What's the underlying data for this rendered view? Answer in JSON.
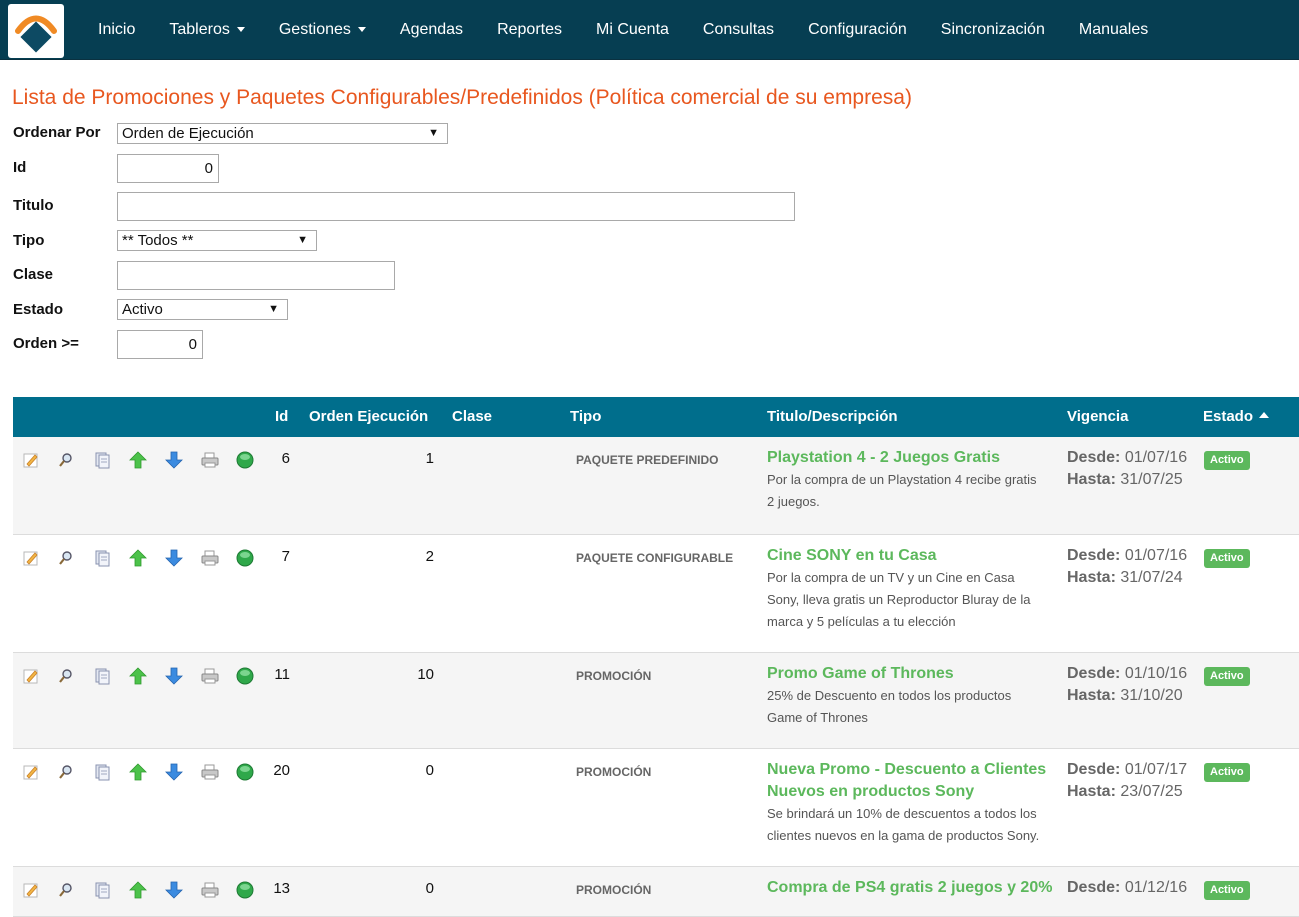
{
  "nav": {
    "items": [
      {
        "label": "Inicio",
        "dropdown": false
      },
      {
        "label": "Tableros",
        "dropdown": true
      },
      {
        "label": "Gestiones",
        "dropdown": true
      },
      {
        "label": "Agendas",
        "dropdown": false
      },
      {
        "label": "Reportes",
        "dropdown": false
      },
      {
        "label": "Mi Cuenta",
        "dropdown": false
      },
      {
        "label": "Consultas",
        "dropdown": false
      },
      {
        "label": "Configuración",
        "dropdown": false
      },
      {
        "label": "Sincronización",
        "dropdown": false
      },
      {
        "label": "Manuales",
        "dropdown": false
      }
    ]
  },
  "page_title": "Lista de Promociones y Paquetes Configurables/Predefinidos (Política comercial de su empresa)",
  "filters": {
    "ordenar_por": {
      "label": "Ordenar Por",
      "value": "Orden de Ejecución"
    },
    "id": {
      "label": "Id",
      "value": "0"
    },
    "titulo": {
      "label": "Titulo",
      "value": ""
    },
    "tipo": {
      "label": "Tipo",
      "value": "** Todos **"
    },
    "clase": {
      "label": "Clase",
      "value": ""
    },
    "estado": {
      "label": "Estado",
      "value": "Activo"
    },
    "orden": {
      "label": "Orden >=",
      "value": "0"
    }
  },
  "table": {
    "headers": {
      "id": "Id",
      "orden": "Orden Ejecución",
      "clase": "Clase",
      "tipo": "Tipo",
      "titulo": "Titulo/Descripción",
      "vigencia": "Vigencia",
      "estado": "Estado"
    },
    "desde_label": "Desde:",
    "hasta_label": "Hasta:",
    "rows": [
      {
        "id": "6",
        "orden": "1",
        "clase": "",
        "tipo": "PAQUETE PREDEFINIDO",
        "title_lines": [
          "Playstation 4 - 2 Juegos Gratis"
        ],
        "desc_lines": [
          "Por la compra de un Playstation 4 recibe gratis",
          "2 juegos."
        ],
        "desde": "01/07/16",
        "hasta": "31/07/25",
        "estado": "Activo"
      },
      {
        "id": "7",
        "orden": "2",
        "clase": "",
        "tipo": "PAQUETE CONFIGURABLE",
        "title_lines": [
          "Cine SONY en tu Casa"
        ],
        "desc_lines": [
          "Por la compra de un TV y un Cine en Casa",
          "Sony, lleva gratis un Reproductor Bluray de la",
          "marca y 5 películas a tu elección"
        ],
        "desde": "01/07/16",
        "hasta": "31/07/24",
        "estado": "Activo"
      },
      {
        "id": "11",
        "orden": "10",
        "clase": "",
        "tipo": "PROMOCIÓN",
        "title_lines": [
          "Promo Game of Thrones"
        ],
        "desc_lines": [
          "25% de Descuento en todos los productos",
          "Game of Thrones"
        ],
        "desde": "01/10/16",
        "hasta": "31/10/20",
        "estado": "Activo"
      },
      {
        "id": "20",
        "orden": "0",
        "clase": "",
        "tipo": "PROMOCIÓN",
        "title_lines": [
          "Nueva Promo - Descuento a Clientes",
          "Nuevos en productos Sony"
        ],
        "desc_lines": [
          "Se brindará un 10% de descuentos a todos los",
          "clientes nuevos en la gama de productos Sony."
        ],
        "desde": "01/07/17",
        "hasta": "23/07/25",
        "estado": "Activo"
      },
      {
        "id": "13",
        "orden": "0",
        "clase": "",
        "tipo": "PROMOCIÓN",
        "title_lines": [
          "Compra de PS4 gratis 2 juegos y 20%"
        ],
        "desc_lines": [],
        "desde": "01/12/16",
        "hasta": "",
        "estado": "Activo"
      }
    ]
  },
  "colors": {
    "navbar": "#063e52",
    "title": "#e8571f",
    "table_header": "#006e8c",
    "accent_green": "#5cb85c"
  },
  "row_icons": [
    "edit-icon",
    "search-icon",
    "copy-icon",
    "arrow-up-icon",
    "arrow-down-icon",
    "print-icon",
    "status-dot-icon"
  ]
}
